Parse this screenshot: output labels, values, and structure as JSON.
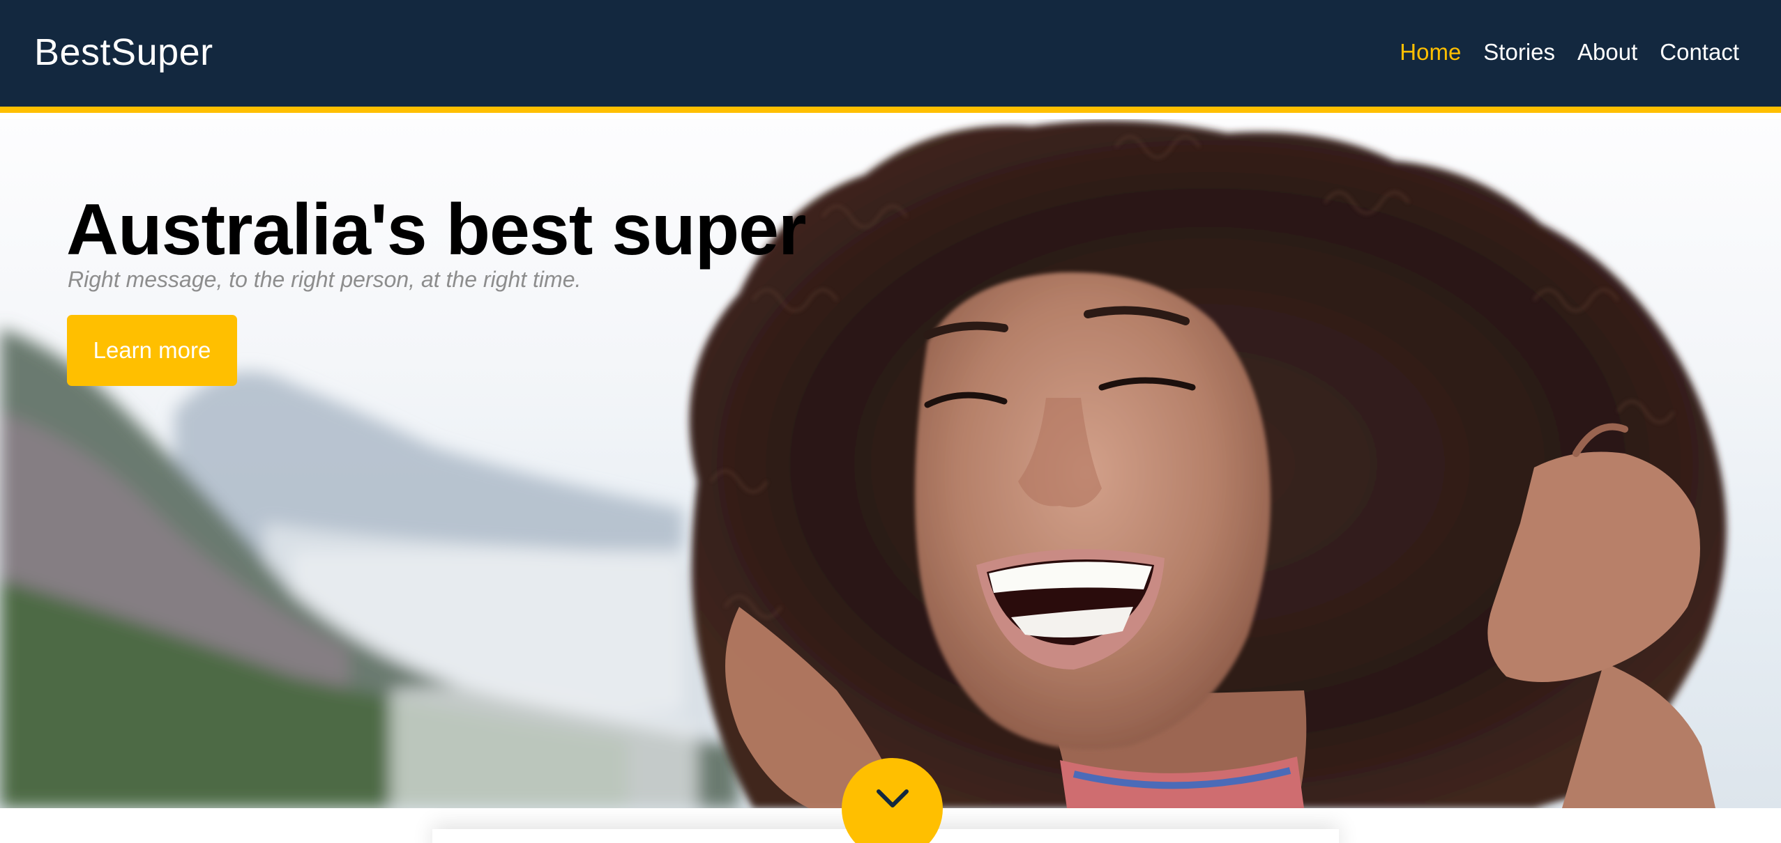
{
  "brand": "BestSuper",
  "nav": {
    "items": [
      {
        "label": "Home",
        "active": true
      },
      {
        "label": "Stories",
        "active": false
      },
      {
        "label": "About",
        "active": false
      },
      {
        "label": "Contact",
        "active": false
      }
    ]
  },
  "hero": {
    "title": "Australia's best super",
    "subtitle": "Right message, to the right person, at the right time.",
    "cta_label": "Learn more",
    "scroll_icon": "chevron-down-icon"
  },
  "colors": {
    "navbar_bg": "#13283f",
    "accent": "#ffbf00",
    "text_dark": "#000000",
    "subtitle": "#8d8d8d"
  }
}
